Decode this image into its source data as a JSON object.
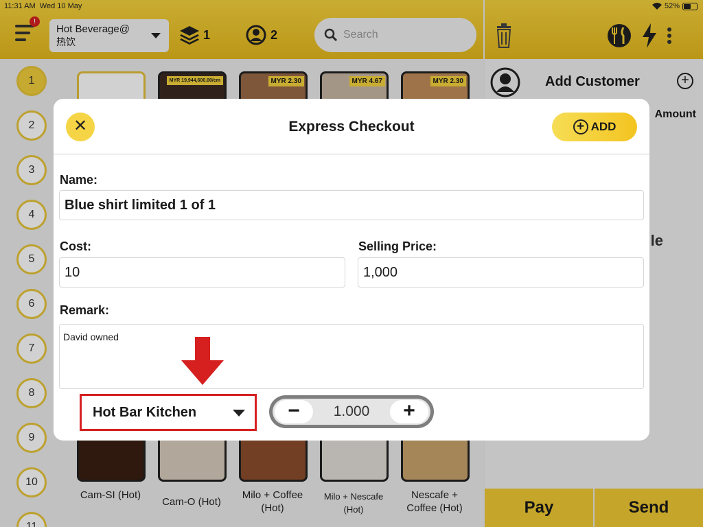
{
  "status": {
    "time": "11:31 AM",
    "date": "Wed 10 May",
    "battery": "52%"
  },
  "header": {
    "notification_count": "!",
    "category_name": "Hot Beverage@",
    "category_sub": "热饮",
    "layers_count": "1",
    "guests_count": "2",
    "search_placeholder": "Search"
  },
  "tables": [
    "1",
    "2",
    "3",
    "4",
    "5",
    "6",
    "7",
    "8",
    "9",
    "10",
    "11"
  ],
  "menu": {
    "prices": [
      "MYR 19,944,600.00/cm",
      "MYR 2.30",
      "MYR 4.67",
      "MYR 2.30"
    ],
    "items": [
      "Cam-SI (Hot)",
      "Cam-O (Hot)",
      "Milo + Coffee (Hot)",
      "Milo + Nescafe (Hot)",
      "Nescafe + Coffee (Hot)"
    ]
  },
  "cart": {
    "add_customer": "Add Customer",
    "amount_header": "Amount",
    "partial_text": "le",
    "pay_label": "Pay",
    "send_label": "Send"
  },
  "modal": {
    "title": "Express Checkout",
    "add_label": "ADD",
    "name_label": "Name:",
    "name_value": "Blue shirt limited 1 of 1",
    "cost_label": "Cost:",
    "cost_value": "10",
    "selling_price_label": "Selling Price:",
    "selling_price_value": "1,000",
    "remark_label": "Remark:",
    "remark_value": "David owned",
    "kitchen_value": "Hot Bar Kitchen",
    "quantity_value": "1.000"
  },
  "colors": {
    "accent": "#f3cd33",
    "highlight": "#d62020"
  }
}
